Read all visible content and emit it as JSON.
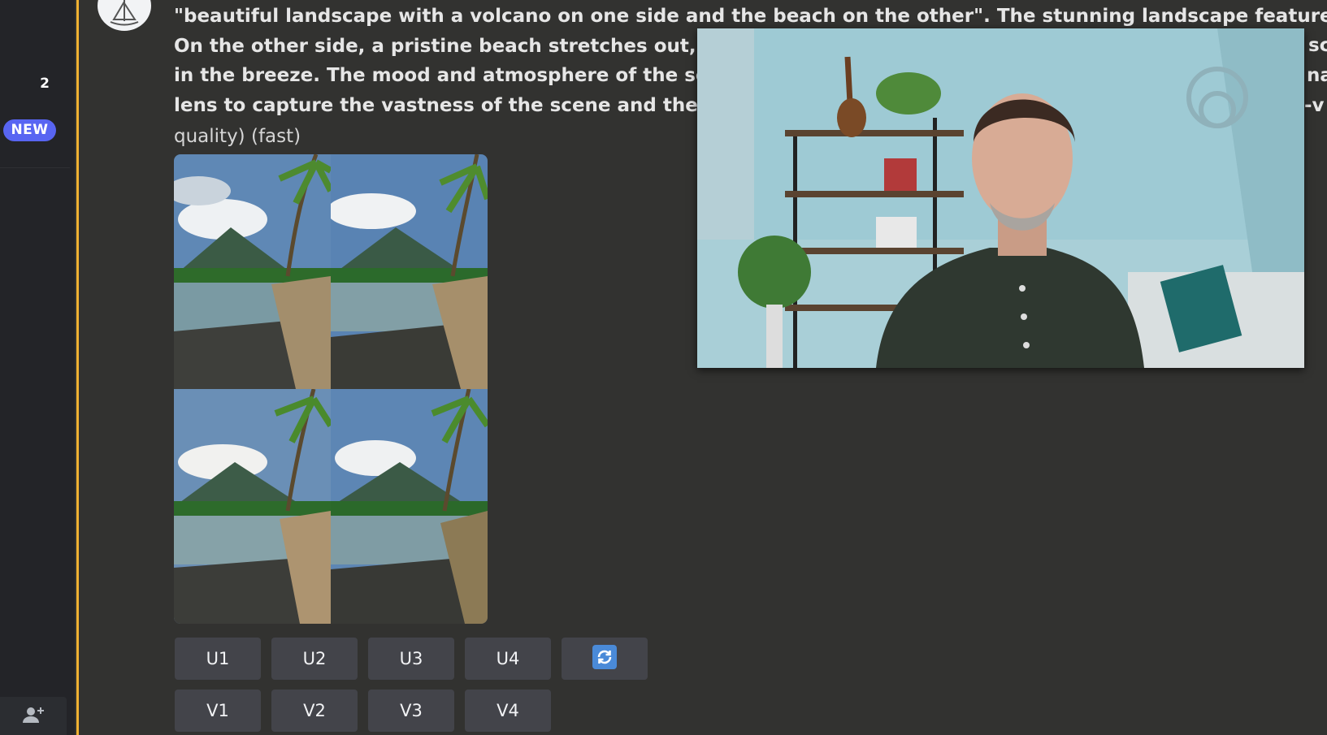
{
  "sidebar": {
    "count": "2",
    "new_badge": "NEW",
    "icons": {
      "add_member": "add-member-icon"
    }
  },
  "message": {
    "avatar_icon": "sailboat-icon",
    "prompt_lines": [
      "\"beautiful landscape with a volcano on one side and the beach on the other\". The stunning landscape features a towering",
      "On the other side, a pristine beach stretches out, with c",
      "in the breeze. The mood and atmosphere of the scene e",
      "lens to capture the vastness of the scene and the contra"
    ],
    "prompt_right_fragments": [
      "sc",
      "na",
      "-v !"
    ],
    "tail": "quality) (fast)"
  },
  "image_grid": {
    "tiles": [
      "image-1",
      "image-2",
      "image-3",
      "image-4"
    ]
  },
  "buttons": {
    "upscale": [
      "U1",
      "U2",
      "U3",
      "U4"
    ],
    "variation": [
      "V1",
      "V2",
      "V3",
      "V4"
    ],
    "reroll_icon": "refresh-icon"
  },
  "colors": {
    "accent": "#f0b132",
    "blurple": "#5865f2",
    "button": "#43444a",
    "background": "#323230",
    "reroll": "#4a8ad8"
  }
}
